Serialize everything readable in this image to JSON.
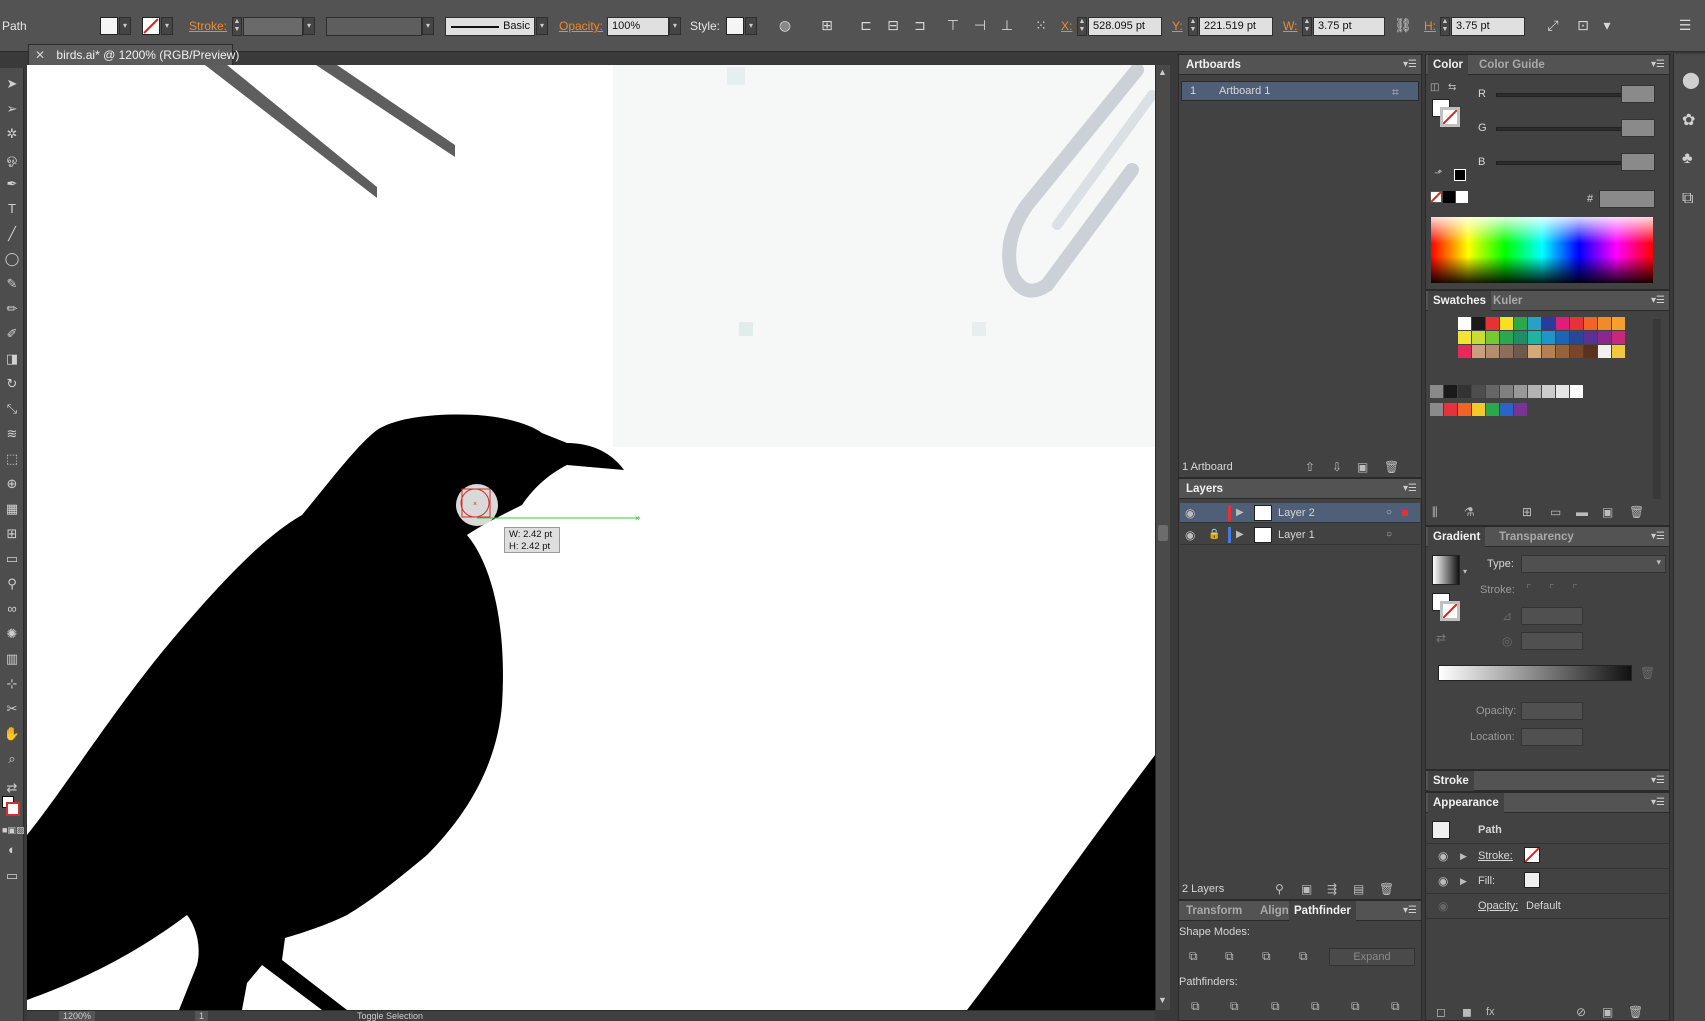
{
  "control_bar": {
    "selection_type": "Path",
    "stroke_label": "Stroke:",
    "brush_label": "Basic",
    "opacity_label": "Opacity:",
    "opacity_value": "100%",
    "style_label": "Style:",
    "x_label": "X:",
    "x_value": "528.095 pt",
    "y_label": "Y:",
    "y_value": "221.519 pt",
    "w_label": "W:",
    "w_value": "3.75 pt",
    "h_label": "H:",
    "h_value": "3.75 pt"
  },
  "document": {
    "tab_title": "birds.ai* @ 1200% (RGB/Preview)",
    "zoom": "1200%",
    "page": "1",
    "status": "Toggle Selection"
  },
  "tooltip": {
    "w": "W: 2.42 pt",
    "h": "H: 2.42 pt"
  },
  "artboards": {
    "tab": "Artboards",
    "row_num": "1",
    "row_name": "Artboard 1",
    "footer": "1 Artboard"
  },
  "layers": {
    "tab": "Layers",
    "items": [
      {
        "name": "Layer 2",
        "color": "#e03333"
      },
      {
        "name": "Layer 1",
        "color": "#4a78e0"
      }
    ],
    "footer": "2 Layers"
  },
  "pathfinder": {
    "tabs": [
      "Transform",
      "Align",
      "Pathfinder"
    ],
    "shape_modes": "Shape Modes:",
    "expand": "Expand",
    "pathfinders": "Pathfinders:"
  },
  "color": {
    "tabs": [
      "Color",
      "Color Guide"
    ],
    "channels": [
      "R",
      "G",
      "B"
    ],
    "hash": "#"
  },
  "swatches": {
    "tabs": [
      "Swatches",
      "Kuler"
    ],
    "row1": [
      "#ffffff",
      "#1a1a1a",
      "#e63232",
      "#f5e11e",
      "#2aa84a",
      "#2aa0c8",
      "#2a3c9a",
      "#e01e78",
      "#e6323c",
      "#f0642a",
      "#f08c28",
      "#f5a028"
    ],
    "row2": [
      "#f0e632",
      "#c8dc32",
      "#78c832",
      "#28a850",
      "#1e8c64",
      "#1eb4a0",
      "#1e96c8",
      "#1e64b4",
      "#28469a",
      "#5a3296",
      "#8c288c",
      "#c8287a"
    ],
    "row3": [
      "#e6285a",
      "#c8a080",
      "#b48c6e",
      "#8c6e5a",
      "#6e5a4a",
      "#d2aa78",
      "#b48250",
      "#96643c",
      "#784628",
      "#5a3220",
      "#f0f0f0",
      "#f0c840"
    ],
    "grays": [
      "#1a1a1a",
      "#333333",
      "#4d4d4d",
      "#666666",
      "#808080",
      "#999999",
      "#b3b3b3",
      "#cccccc",
      "#e6e6e6",
      "#ffffff"
    ],
    "group2": [
      "#e6323c",
      "#f0642a",
      "#f5c828",
      "#2aa84a",
      "#2a64c8",
      "#7a3296"
    ]
  },
  "gradient": {
    "tabs": [
      "Gradient",
      "Transparency"
    ],
    "type_label": "Type:",
    "stroke_label": "Stroke:",
    "opacity_label": "Opacity:",
    "location_label": "Location:"
  },
  "stroke_panel": {
    "tab": "Stroke"
  },
  "appearance": {
    "tab": "Appearance",
    "object": "Path",
    "stroke": "Stroke:",
    "fill": "Fill:",
    "opacity": "Opacity:",
    "opacity_value": "Default"
  }
}
